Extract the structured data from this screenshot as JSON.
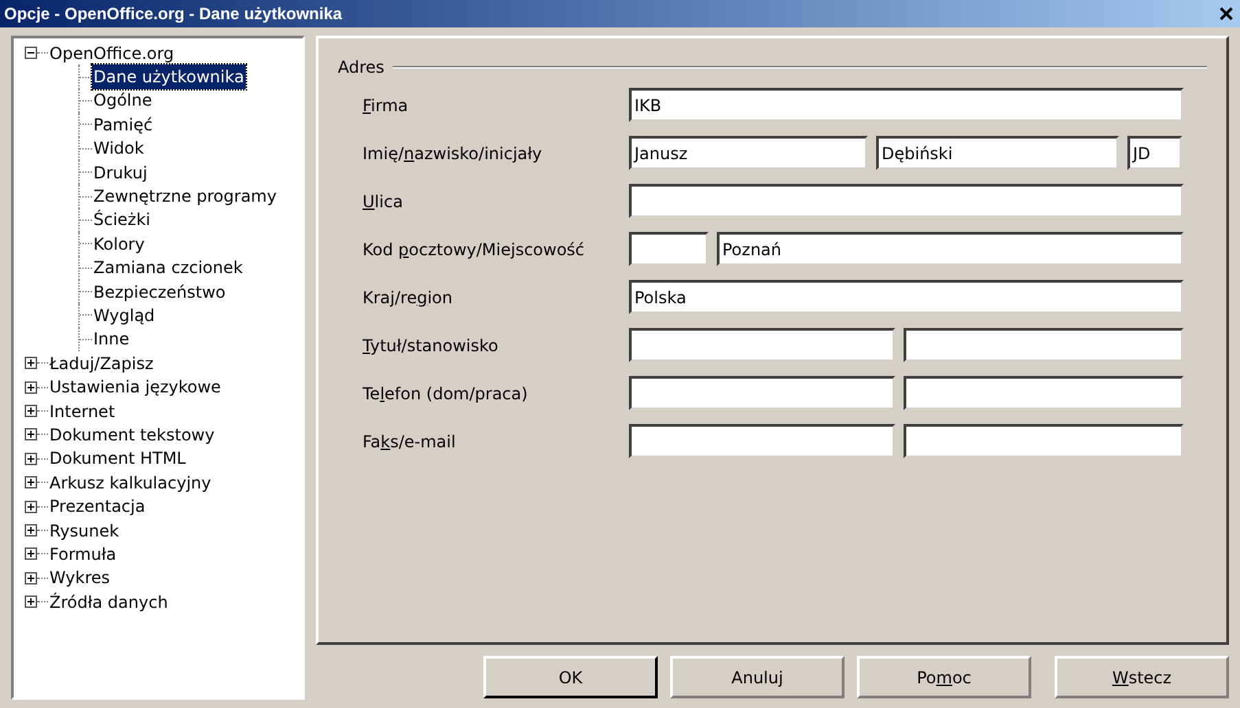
{
  "window": {
    "title": "Opcje - OpenOffice.org - Dane użytkownika"
  },
  "tree": [
    {
      "label": "OpenOffice.org",
      "expanded": true,
      "children": [
        {
          "label": "Dane użytkownika",
          "selected": true
        },
        {
          "label": "Ogólne",
          "selected": false
        },
        {
          "label": "Pamięć",
          "selected": false
        },
        {
          "label": "Widok",
          "selected": false
        },
        {
          "label": "Drukuj",
          "selected": false
        },
        {
          "label": "Zewnętrzne programy",
          "selected": false
        },
        {
          "label": "Ścieżki",
          "selected": false
        },
        {
          "label": "Kolory",
          "selected": false
        },
        {
          "label": "Zamiana czcionek",
          "selected": false
        },
        {
          "label": "Bezpieczeństwo",
          "selected": false
        },
        {
          "label": "Wygląd",
          "selected": false
        },
        {
          "label": "Inne",
          "selected": false
        }
      ]
    },
    {
      "label": "Ładuj/Zapisz",
      "expanded": false
    },
    {
      "label": "Ustawienia językowe",
      "expanded": false
    },
    {
      "label": "Internet",
      "expanded": false
    },
    {
      "label": "Dokument tekstowy",
      "expanded": false
    },
    {
      "label": "Dokument HTML",
      "expanded": false
    },
    {
      "label": "Arkusz kalkulacyjny",
      "expanded": false
    },
    {
      "label": "Prezentacja",
      "expanded": false
    },
    {
      "label": "Rysunek",
      "expanded": false
    },
    {
      "label": "Formuła",
      "expanded": false
    },
    {
      "label": "Wykres",
      "expanded": false
    },
    {
      "label": "Źródła danych",
      "expanded": false
    }
  ],
  "group": {
    "title": "Adres",
    "rows": [
      {
        "label": {
          "key": "F",
          "after": "irma"
        },
        "kind": "single",
        "fields": [
          {
            "kind": "text",
            "value": "IKB"
          }
        ]
      },
      {
        "label": {
          "before": "Imię/",
          "key": "n",
          "after": "azwisko/inicjały"
        },
        "kind": "name",
        "fields": [
          {
            "kind": "text",
            "value": "Janusz"
          },
          {
            "kind": "text",
            "value": "Dębiński"
          },
          {
            "kind": "text",
            "value": "JD"
          }
        ]
      },
      {
        "label": {
          "key": "U",
          "after": "lica"
        },
        "kind": "single",
        "fields": [
          {
            "kind": "empty"
          }
        ]
      },
      {
        "label": {
          "before": "Kod ",
          "key": "p",
          "after": "ocztowy/Miejscowość"
        },
        "kind": "postal",
        "fields": [
          {
            "kind": "empty"
          },
          {
            "kind": "text",
            "value": "Poznań"
          }
        ]
      },
      {
        "label": {
          "before": "Kraj/re",
          "key": "g",
          "after": "ion"
        },
        "kind": "single",
        "fields": [
          {
            "kind": "text",
            "value": "Polska"
          }
        ]
      },
      {
        "label": {
          "key": "T",
          "after": "ytuł/stanowisko"
        },
        "kind": "pair",
        "fields": [
          {
            "kind": "empty"
          },
          {
            "kind": "empty"
          }
        ]
      },
      {
        "label": {
          "before": "Te",
          "key": "l",
          "after": "efon (dom/praca)"
        },
        "kind": "pair",
        "fields": [
          {
            "kind": "empty"
          },
          {
            "kind": "empty"
          }
        ]
      },
      {
        "label": {
          "before": "Fa",
          "key": "k",
          "after": "s/e-mail"
        },
        "kind": "pair",
        "fields": [
          {
            "kind": "empty"
          },
          {
            "kind": "empty"
          }
        ]
      }
    ]
  },
  "buttons": [
    {
      "label": {
        "before": "OK"
      },
      "default": true
    },
    {
      "label": {
        "before": "Anuluj"
      },
      "default": false
    },
    {
      "label": {
        "before": "Po",
        "key": "m",
        "after": "oc"
      },
      "default": false
    },
    {
      "label": {
        "key": "W",
        "after": "stecz"
      },
      "default": false
    }
  ]
}
